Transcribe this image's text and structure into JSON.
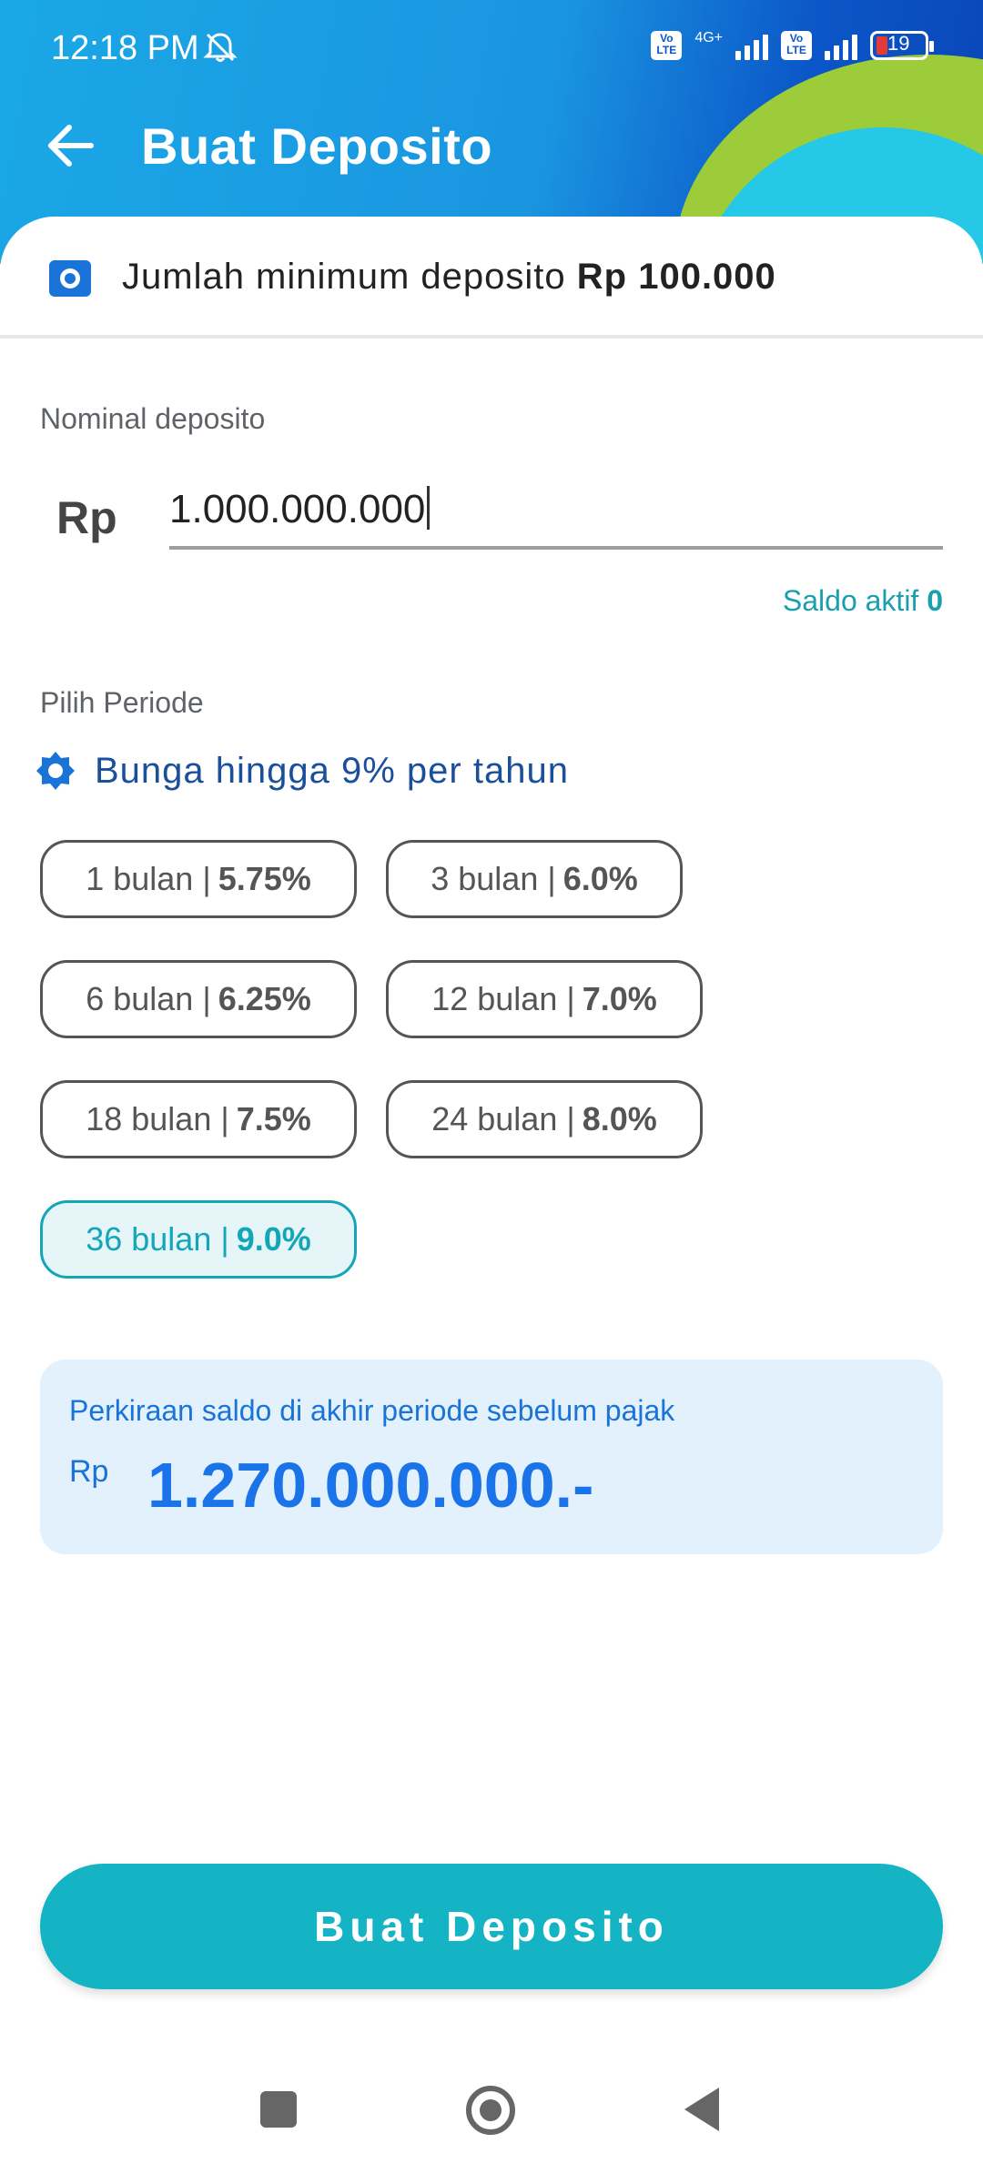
{
  "status_bar": {
    "time": "12:18 PM",
    "network_label": "4G+",
    "volte_label": "Vo LTE",
    "battery_level": "19"
  },
  "header": {
    "title": "Buat Deposito"
  },
  "min_info": {
    "text": "Jumlah minimum deposito",
    "amount": "Rp 100.000"
  },
  "deposit": {
    "label": "Nominal deposito",
    "currency": "Rp",
    "value": "1.000.000.000",
    "saldo_label": "Saldo aktif",
    "saldo_value": "0"
  },
  "period": {
    "label": "Pilih Periode",
    "bunga_text": "Bunga hingga 9% per tahun",
    "options": [
      {
        "term": "1 bulan |",
        "rate": "5.75%"
      },
      {
        "term": "3 bulan |",
        "rate": "6.0%"
      },
      {
        "term": "6 bulan |",
        "rate": "6.25%"
      },
      {
        "term": "12 bulan |",
        "rate": "7.0%"
      },
      {
        "term": "18 bulan |",
        "rate": "7.5%"
      },
      {
        "term": "24 bulan |",
        "rate": "8.0%"
      },
      {
        "term": "36 bulan |",
        "rate": "9.0%"
      }
    ],
    "selected": "36 bulan"
  },
  "estimate": {
    "label": "Perkiraan saldo di akhir periode sebelum pajak",
    "currency": "Rp",
    "value": "1.270.000.000.-"
  },
  "cta": {
    "label": "Buat Deposito"
  },
  "colors": {
    "primary": "#14b4c4",
    "accent_blue": "#1a73e8",
    "header_blue": "#1a95e0"
  }
}
